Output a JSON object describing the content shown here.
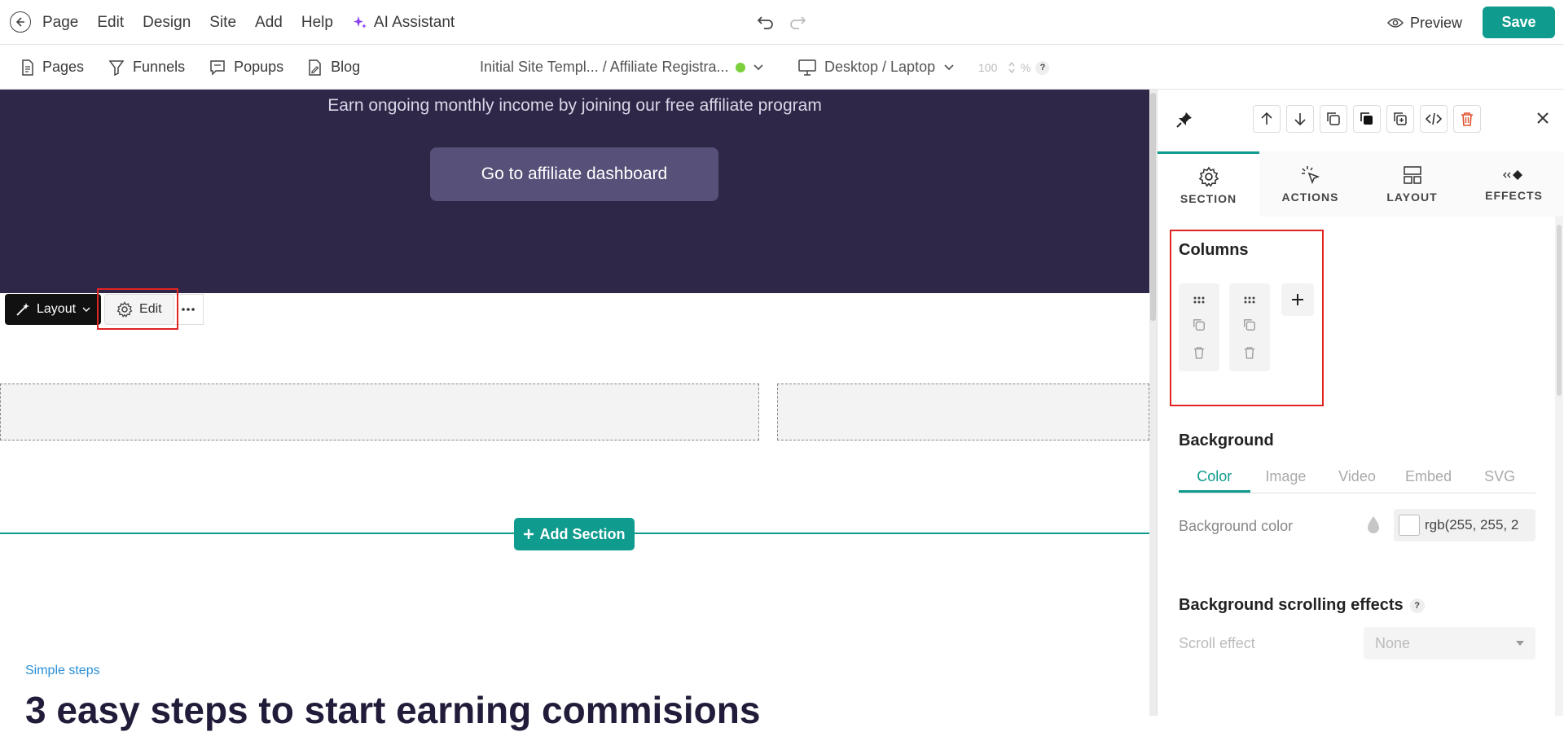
{
  "topbar": {
    "menu": [
      "Page",
      "Edit",
      "Design",
      "Site",
      "Add",
      "Help"
    ],
    "ai_assistant": "AI Assistant",
    "preview_label": "Preview",
    "save_label": "Save"
  },
  "subbar": {
    "nav": [
      "Pages",
      "Funnels",
      "Popups",
      "Blog"
    ],
    "breadcrumb": "Initial Site Templ... / Affiliate Registra...",
    "device": "Desktop / Laptop",
    "zoom": "100",
    "zoom_unit": "%",
    "help": "?"
  },
  "canvas": {
    "hero_text": "Earn ongoing monthly income by joining our free affiliate program",
    "hero_button": "Go to affiliate dashboard",
    "layout_button": "Layout",
    "edit_button": "Edit",
    "add_section": "Add Section",
    "steps_label": "Simple steps",
    "steps_title": "3 easy steps to start earning commisions"
  },
  "panel": {
    "tabs": [
      "SECTION",
      "ACTIONS",
      "LAYOUT",
      "EFFECTS"
    ],
    "active_tab": "SECTION",
    "columns_title": "Columns",
    "columns_count": 2,
    "background_title": "Background",
    "bg_tabs": [
      "Color",
      "Image",
      "Video",
      "Embed",
      "SVG"
    ],
    "bg_color_label": "Background color",
    "bg_color_value": "rgb(255, 255, 2",
    "scroll_effects_title": "Background scrolling effects",
    "scroll_effect_label": "Scroll effect",
    "scroll_effect_value": "None"
  },
  "colors": {
    "accent": "#0f9b8e",
    "hero_bg": "#2e2748",
    "hero_button": "#575078",
    "highlight": "#e02424"
  }
}
